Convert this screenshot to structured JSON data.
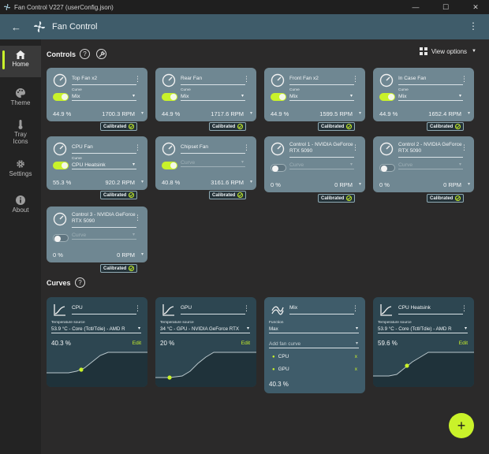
{
  "window": {
    "title": "Fan Control V227 (userConfig.json)"
  },
  "appbar": {
    "title": "Fan Control"
  },
  "sidebar": {
    "items": [
      {
        "label": "Home"
      },
      {
        "label": "Theme"
      },
      {
        "label": "Tray\nIcons"
      },
      {
        "label": "Settings"
      },
      {
        "label": "About"
      }
    ]
  },
  "controls": {
    "header": "Controls",
    "view_options": "View options",
    "calibrated_label": "Calibrated",
    "curve_label": "Curve",
    "cards": [
      {
        "name": "Top Fan x2",
        "enabled": true,
        "curve": "Mix",
        "percent": "44.9 %",
        "rpm": "1700.3 RPM"
      },
      {
        "name": "Rear Fan",
        "enabled": true,
        "curve": "Mix",
        "percent": "44.9 %",
        "rpm": "1717.6 RPM"
      },
      {
        "name": "Front Fan x2",
        "enabled": true,
        "curve": "Mix",
        "percent": "44.9 %",
        "rpm": "1599.5 RPM"
      },
      {
        "name": "In Case Fan",
        "enabled": true,
        "curve": "Mix",
        "percent": "44.9 %",
        "rpm": "1652.4 RPM"
      },
      {
        "name": "CPU Fan",
        "enabled": true,
        "curve": "CPU Heatsink",
        "percent": "55.3 %",
        "rpm": "920.2 RPM"
      },
      {
        "name": "Chipset Fan",
        "enabled": true,
        "curve": "Curve",
        "percent": "40.8 %",
        "rpm": "3161.6 RPM"
      },
      {
        "name": "Control 1 - NVIDIA GeForce RTX 5090",
        "enabled": false,
        "curve": "Curve",
        "percent": "0 %",
        "rpm": "0 RPM"
      },
      {
        "name": "Control 2 - NVIDIA GeForce RTX 5090",
        "enabled": false,
        "curve": "Curve",
        "percent": "0 %",
        "rpm": "0 RPM"
      },
      {
        "name": "Control 3 - NVIDIA GeForce RTX 5090",
        "enabled": false,
        "curve": "Curve",
        "percent": "0 %",
        "rpm": "0 RPM"
      }
    ]
  },
  "curves": {
    "header": "Curves",
    "temp_source_label": "Temperature source",
    "edit_label": "Edit",
    "function_label": "Function",
    "cards": [
      {
        "name": "CPU",
        "source": "53.9 °C - Core (Tctl/Tdie) - AMD R",
        "percent": "40.3 %",
        "point_fraction": 0.403
      },
      {
        "name": "GPU",
        "source": "34 °C - GPU - NVIDIA GeForce RTX",
        "percent": "20 %",
        "point_fraction": 0.2
      },
      {
        "name": "Mix",
        "function": "Max",
        "add_placeholder": "Add fan curve",
        "items": [
          "CPU",
          "GPU"
        ],
        "remove_glyph": "x",
        "percent": "40.3 %"
      },
      {
        "name": "CPU Heatsink",
        "source": "53.9 °C - Core (Tctl/Tdie) - AMD R",
        "percent": "59.6 %",
        "point_fraction": 0.596
      }
    ]
  },
  "fab": {
    "label": "+"
  },
  "colors": {
    "accent": "#c9f22a",
    "appbar": "#3f5c6a",
    "card": "#6f8792",
    "curve_card": "#2d4651"
  }
}
